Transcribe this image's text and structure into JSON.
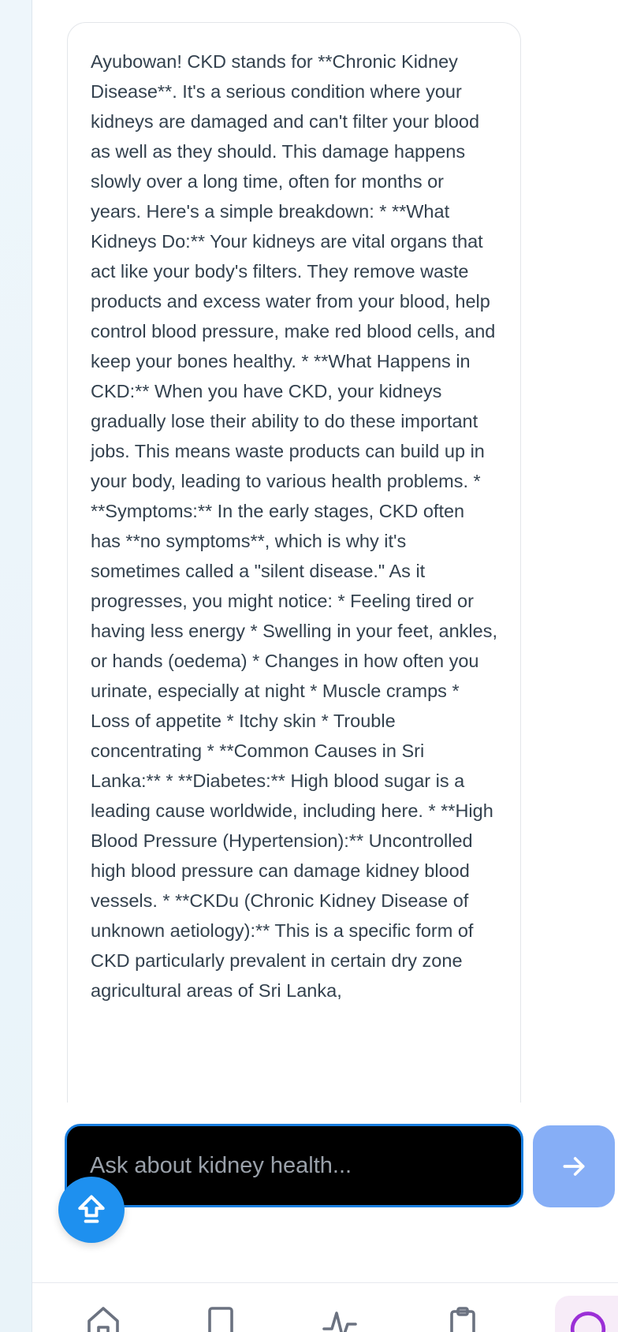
{
  "chat": {
    "messages": [
      {
        "role": "assistant",
        "text": "Ayubowan! CKD stands for **Chronic Kidney Disease**. It's a serious condition where your kidneys are damaged and can't filter your blood as well as they should. This damage happens slowly over a long time, often for months or years. Here's a simple breakdown: * **What Kidneys Do:** Your kidneys are vital organs that act like your body's filters. They remove waste products and excess water from your blood, help control blood pressure, make red blood cells, and keep your bones healthy. * **What Happens in CKD:** When you have CKD, your kidneys gradually lose their ability to do these important jobs. This means waste products can build up in your body, leading to various health problems. * **Symptoms:** In the early stages, CKD often has **no symptoms**, which is why it's sometimes called a \"silent disease.\" As it progresses, you might notice: * Feeling tired or having less energy * Swelling in your feet, ankles, or hands (oedema) * Changes in how often you urinate, especially at night * Muscle cramps * Loss of appetite * Itchy skin * Trouble concentrating * **Common Causes in Sri Lanka:** * **Diabetes:** High blood sugar is a leading cause worldwide, including here. * **High Blood Pressure (Hypertension):** Uncontrolled high blood pressure can damage kidney blood vessels. * **CKDu (Chronic Kidney Disease of unknown aetiology):** This is a specific form of CKD particularly prevalent in certain dry zone agricultural areas of Sri Lanka,"
      }
    ]
  },
  "composer": {
    "value": "",
    "placeholder": "Ask about kidney health..."
  },
  "icons": {
    "send": "arrow-right-icon",
    "scroll_top": "arrow-up-circle-icon",
    "nav": [
      "home-icon",
      "book-icon",
      "activity-icon",
      "clipboard-icon",
      "chat-icon"
    ]
  },
  "colors": {
    "accent": "#1a7fe0",
    "send_button": "#86aef6",
    "scroll_button": "#1e90ef",
    "active_nav": "#9b2fd6"
  }
}
